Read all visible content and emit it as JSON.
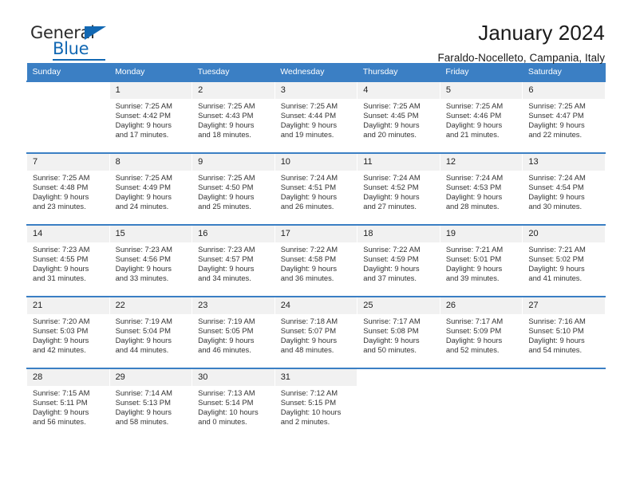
{
  "brand": {
    "name_part1": "General",
    "name_part2": "Blue",
    "accent_color": "#1268b3"
  },
  "header": {
    "title": "January 2024",
    "subtitle": "Faraldo-Nocelleto, Campania, Italy"
  },
  "theme": {
    "header_row_color": "#3b7fc4",
    "daynum_bg": "#f1f1f1",
    "text_color": "#333333"
  },
  "weekdays": [
    "Sunday",
    "Monday",
    "Tuesday",
    "Wednesday",
    "Thursday",
    "Friday",
    "Saturday"
  ],
  "weeks": [
    [
      {
        "day": "",
        "sunrise": "",
        "sunset": "",
        "daylight1": "",
        "daylight2": ""
      },
      {
        "day": "1",
        "sunrise": "Sunrise: 7:25 AM",
        "sunset": "Sunset: 4:42 PM",
        "daylight1": "Daylight: 9 hours",
        "daylight2": "and 17 minutes."
      },
      {
        "day": "2",
        "sunrise": "Sunrise: 7:25 AM",
        "sunset": "Sunset: 4:43 PM",
        "daylight1": "Daylight: 9 hours",
        "daylight2": "and 18 minutes."
      },
      {
        "day": "3",
        "sunrise": "Sunrise: 7:25 AM",
        "sunset": "Sunset: 4:44 PM",
        "daylight1": "Daylight: 9 hours",
        "daylight2": "and 19 minutes."
      },
      {
        "day": "4",
        "sunrise": "Sunrise: 7:25 AM",
        "sunset": "Sunset: 4:45 PM",
        "daylight1": "Daylight: 9 hours",
        "daylight2": "and 20 minutes."
      },
      {
        "day": "5",
        "sunrise": "Sunrise: 7:25 AM",
        "sunset": "Sunset: 4:46 PM",
        "daylight1": "Daylight: 9 hours",
        "daylight2": "and 21 minutes."
      },
      {
        "day": "6",
        "sunrise": "Sunrise: 7:25 AM",
        "sunset": "Sunset: 4:47 PM",
        "daylight1": "Daylight: 9 hours",
        "daylight2": "and 22 minutes."
      }
    ],
    [
      {
        "day": "7",
        "sunrise": "Sunrise: 7:25 AM",
        "sunset": "Sunset: 4:48 PM",
        "daylight1": "Daylight: 9 hours",
        "daylight2": "and 23 minutes."
      },
      {
        "day": "8",
        "sunrise": "Sunrise: 7:25 AM",
        "sunset": "Sunset: 4:49 PM",
        "daylight1": "Daylight: 9 hours",
        "daylight2": "and 24 minutes."
      },
      {
        "day": "9",
        "sunrise": "Sunrise: 7:25 AM",
        "sunset": "Sunset: 4:50 PM",
        "daylight1": "Daylight: 9 hours",
        "daylight2": "and 25 minutes."
      },
      {
        "day": "10",
        "sunrise": "Sunrise: 7:24 AM",
        "sunset": "Sunset: 4:51 PM",
        "daylight1": "Daylight: 9 hours",
        "daylight2": "and 26 minutes."
      },
      {
        "day": "11",
        "sunrise": "Sunrise: 7:24 AM",
        "sunset": "Sunset: 4:52 PM",
        "daylight1": "Daylight: 9 hours",
        "daylight2": "and 27 minutes."
      },
      {
        "day": "12",
        "sunrise": "Sunrise: 7:24 AM",
        "sunset": "Sunset: 4:53 PM",
        "daylight1": "Daylight: 9 hours",
        "daylight2": "and 28 minutes."
      },
      {
        "day": "13",
        "sunrise": "Sunrise: 7:24 AM",
        "sunset": "Sunset: 4:54 PM",
        "daylight1": "Daylight: 9 hours",
        "daylight2": "and 30 minutes."
      }
    ],
    [
      {
        "day": "14",
        "sunrise": "Sunrise: 7:23 AM",
        "sunset": "Sunset: 4:55 PM",
        "daylight1": "Daylight: 9 hours",
        "daylight2": "and 31 minutes."
      },
      {
        "day": "15",
        "sunrise": "Sunrise: 7:23 AM",
        "sunset": "Sunset: 4:56 PM",
        "daylight1": "Daylight: 9 hours",
        "daylight2": "and 33 minutes."
      },
      {
        "day": "16",
        "sunrise": "Sunrise: 7:23 AM",
        "sunset": "Sunset: 4:57 PM",
        "daylight1": "Daylight: 9 hours",
        "daylight2": "and 34 minutes."
      },
      {
        "day": "17",
        "sunrise": "Sunrise: 7:22 AM",
        "sunset": "Sunset: 4:58 PM",
        "daylight1": "Daylight: 9 hours",
        "daylight2": "and 36 minutes."
      },
      {
        "day": "18",
        "sunrise": "Sunrise: 7:22 AM",
        "sunset": "Sunset: 4:59 PM",
        "daylight1": "Daylight: 9 hours",
        "daylight2": "and 37 minutes."
      },
      {
        "day": "19",
        "sunrise": "Sunrise: 7:21 AM",
        "sunset": "Sunset: 5:01 PM",
        "daylight1": "Daylight: 9 hours",
        "daylight2": "and 39 minutes."
      },
      {
        "day": "20",
        "sunrise": "Sunrise: 7:21 AM",
        "sunset": "Sunset: 5:02 PM",
        "daylight1": "Daylight: 9 hours",
        "daylight2": "and 41 minutes."
      }
    ],
    [
      {
        "day": "21",
        "sunrise": "Sunrise: 7:20 AM",
        "sunset": "Sunset: 5:03 PM",
        "daylight1": "Daylight: 9 hours",
        "daylight2": "and 42 minutes."
      },
      {
        "day": "22",
        "sunrise": "Sunrise: 7:19 AM",
        "sunset": "Sunset: 5:04 PM",
        "daylight1": "Daylight: 9 hours",
        "daylight2": "and 44 minutes."
      },
      {
        "day": "23",
        "sunrise": "Sunrise: 7:19 AM",
        "sunset": "Sunset: 5:05 PM",
        "daylight1": "Daylight: 9 hours",
        "daylight2": "and 46 minutes."
      },
      {
        "day": "24",
        "sunrise": "Sunrise: 7:18 AM",
        "sunset": "Sunset: 5:07 PM",
        "daylight1": "Daylight: 9 hours",
        "daylight2": "and 48 minutes."
      },
      {
        "day": "25",
        "sunrise": "Sunrise: 7:17 AM",
        "sunset": "Sunset: 5:08 PM",
        "daylight1": "Daylight: 9 hours",
        "daylight2": "and 50 minutes."
      },
      {
        "day": "26",
        "sunrise": "Sunrise: 7:17 AM",
        "sunset": "Sunset: 5:09 PM",
        "daylight1": "Daylight: 9 hours",
        "daylight2": "and 52 minutes."
      },
      {
        "day": "27",
        "sunrise": "Sunrise: 7:16 AM",
        "sunset": "Sunset: 5:10 PM",
        "daylight1": "Daylight: 9 hours",
        "daylight2": "and 54 minutes."
      }
    ],
    [
      {
        "day": "28",
        "sunrise": "Sunrise: 7:15 AM",
        "sunset": "Sunset: 5:11 PM",
        "daylight1": "Daylight: 9 hours",
        "daylight2": "and 56 minutes."
      },
      {
        "day": "29",
        "sunrise": "Sunrise: 7:14 AM",
        "sunset": "Sunset: 5:13 PM",
        "daylight1": "Daylight: 9 hours",
        "daylight2": "and 58 minutes."
      },
      {
        "day": "30",
        "sunrise": "Sunrise: 7:13 AM",
        "sunset": "Sunset: 5:14 PM",
        "daylight1": "Daylight: 10 hours",
        "daylight2": "and 0 minutes."
      },
      {
        "day": "31",
        "sunrise": "Sunrise: 7:12 AM",
        "sunset": "Sunset: 5:15 PM",
        "daylight1": "Daylight: 10 hours",
        "daylight2": "and 2 minutes."
      },
      {
        "day": "",
        "sunrise": "",
        "sunset": "",
        "daylight1": "",
        "daylight2": ""
      },
      {
        "day": "",
        "sunrise": "",
        "sunset": "",
        "daylight1": "",
        "daylight2": ""
      },
      {
        "day": "",
        "sunrise": "",
        "sunset": "",
        "daylight1": "",
        "daylight2": ""
      }
    ]
  ]
}
